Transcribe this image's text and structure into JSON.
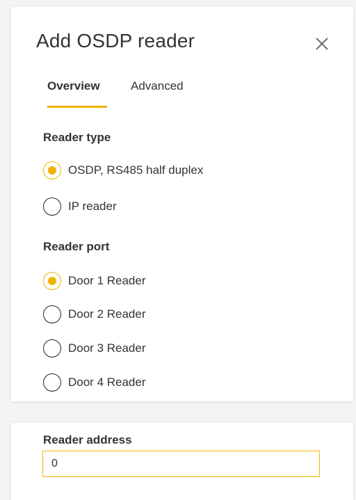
{
  "dialog": {
    "title": "Add OSDP reader",
    "close_icon": "close-icon"
  },
  "tabs": [
    {
      "label": "Overview",
      "active": true
    },
    {
      "label": "Advanced",
      "active": false
    }
  ],
  "reader_type": {
    "label": "Reader type",
    "options": [
      {
        "label": "OSDP, RS485 half duplex",
        "checked": true
      },
      {
        "label": "IP reader",
        "checked": false
      }
    ]
  },
  "reader_port": {
    "label": "Reader port",
    "options": [
      {
        "label": "Door 1 Reader",
        "checked": true
      },
      {
        "label": "Door 2 Reader",
        "checked": false
      },
      {
        "label": "Door 3 Reader",
        "checked": false
      },
      {
        "label": "Door 4 Reader",
        "checked": false
      }
    ]
  },
  "reader_address": {
    "label": "Reader address",
    "value": "0"
  },
  "colors": {
    "accent": "#f0b400",
    "text": "#333333",
    "panel": "#ffffff",
    "background": "#f4f4f4"
  }
}
